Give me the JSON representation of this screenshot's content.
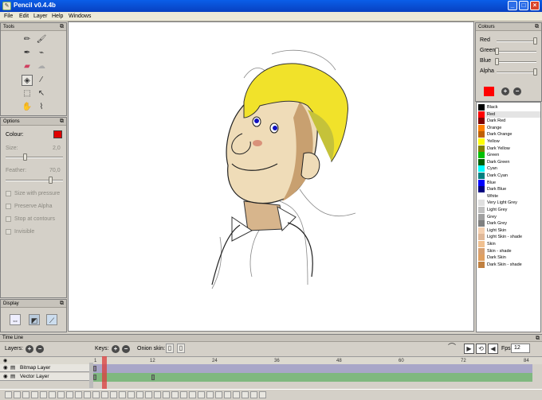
{
  "window": {
    "title": "Pencil v0.4.4b"
  },
  "menu": [
    "File",
    "Edit",
    "Layer",
    "Help",
    "Windows"
  ],
  "tools_panel": {
    "title": "Tools"
  },
  "options_panel": {
    "title": "Options",
    "colour_label": "Colour:",
    "colour_value": "#e00000",
    "size_label": "Size:",
    "size_value": "2,0",
    "feather_label": "Feather:",
    "feather_value": "70,0",
    "checkboxes": [
      "Size with pressure",
      "Preserve Alpha",
      "Stop at contours",
      "Invisible"
    ]
  },
  "display_panel": {
    "title": "Display"
  },
  "colours_panel": {
    "title": "Colours",
    "sliders": [
      {
        "label": "Red",
        "level": 1.0
      },
      {
        "label": "Green",
        "level": 0.0
      },
      {
        "label": "Blue",
        "level": 0.0
      },
      {
        "label": "Alpha",
        "level": 1.0
      }
    ],
    "current": "#ff0000"
  },
  "palette": [
    {
      "name": "Black",
      "color": "#000000"
    },
    {
      "name": "Red",
      "color": "#ff0000"
    },
    {
      "name": "Dark Red",
      "color": "#800000"
    },
    {
      "name": "Orange",
      "color": "#ff8000"
    },
    {
      "name": "Dark Orange",
      "color": "#c06000"
    },
    {
      "name": "Yellow",
      "color": "#ffff00"
    },
    {
      "name": "Dark Yellow",
      "color": "#808000"
    },
    {
      "name": "Green",
      "color": "#00c000"
    },
    {
      "name": "Dark Green",
      "color": "#006000"
    },
    {
      "name": "Cyan",
      "color": "#00ffff"
    },
    {
      "name": "Dark Cyan",
      "color": "#008080"
    },
    {
      "name": "Blue",
      "color": "#0000ff"
    },
    {
      "name": "Dark Blue",
      "color": "#000080"
    },
    {
      "name": "White",
      "color": "#ffffff"
    },
    {
      "name": "Very Light Grey",
      "color": "#e0e0e0"
    },
    {
      "name": "Light Grey",
      "color": "#c0c0c0"
    },
    {
      "name": "Grey",
      "color": "#a0a0a0"
    },
    {
      "name": "Dark Grey",
      "color": "#808080"
    },
    {
      "name": "Light Skin",
      "color": "#f5d0b0"
    },
    {
      "name": "Light Skin - shade",
      "color": "#e0b898"
    },
    {
      "name": "Skin",
      "color": "#f0c090"
    },
    {
      "name": "Skin - shade",
      "color": "#d8a070"
    },
    {
      "name": "Dark Skin",
      "color": "#e0a060"
    },
    {
      "name": "Dark Skin - shade",
      "color": "#c08040"
    }
  ],
  "timeline": {
    "title": "Time Line",
    "layers_label": "Layers:",
    "keys_label": "Keys:",
    "onion_label": "Onion skin:",
    "fps_label": "Fps:",
    "fps_value": "12",
    "ruler": [
      "1",
      "12",
      "24",
      "36",
      "48",
      "60",
      "72",
      "84"
    ],
    "layers": [
      {
        "name": "Bitmap Layer",
        "color": "#a8a6c8"
      },
      {
        "name": "Vector Layer",
        "color": "#7fb87f"
      }
    ]
  }
}
